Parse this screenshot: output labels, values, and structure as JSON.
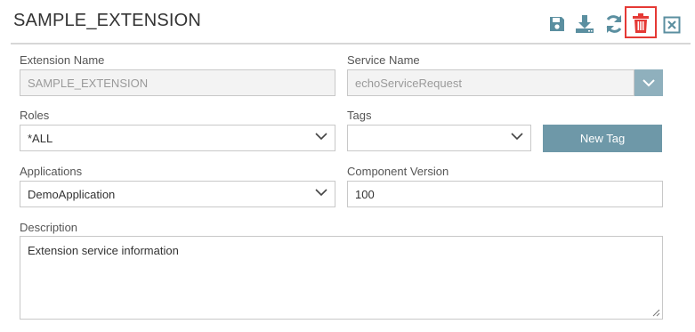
{
  "header": {
    "title": "SAMPLE_EXTENSION"
  },
  "toolbar": {
    "icons": [
      "save-icon",
      "download-icon",
      "refresh-icon",
      "delete-icon",
      "close-icon"
    ],
    "accent_color": "#5b8fa0",
    "delete_color": "#e53935"
  },
  "form": {
    "extension_name": {
      "label": "Extension Name",
      "value": "SAMPLE_EXTENSION"
    },
    "service_name": {
      "label": "Service Name",
      "value": "echoServiceRequest"
    },
    "roles": {
      "label": "Roles",
      "value": "*ALL"
    },
    "tags": {
      "label": "Tags",
      "value": ""
    },
    "new_tag_button": "New Tag",
    "applications": {
      "label": "Applications",
      "value": "DemoApplication"
    },
    "component_version": {
      "label": "Component Version",
      "value": "100"
    },
    "description": {
      "label": "Description",
      "value": "Extension service information"
    }
  }
}
